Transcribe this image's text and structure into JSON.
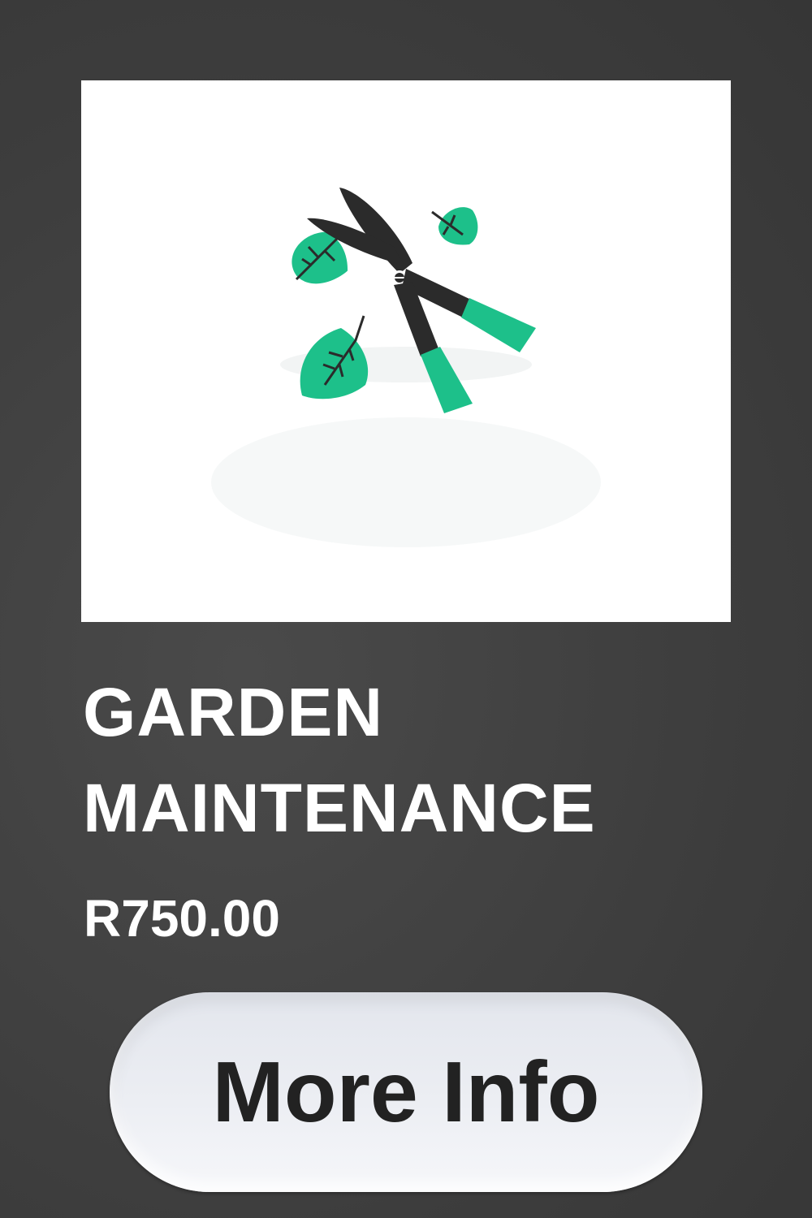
{
  "product": {
    "title_line1": "GARDEN",
    "title_line2": "MAINTENANCE",
    "price": "R750.00",
    "image_icon": "pruning-shears-with-leaves-icon"
  },
  "actions": {
    "more_info_label": "More Info"
  },
  "colors": {
    "background": "#3f3f3f",
    "accent_green": "#1dc08a",
    "tool_dark": "#2b2b2b",
    "button_bg": "#eceef3",
    "button_text": "#222222"
  }
}
